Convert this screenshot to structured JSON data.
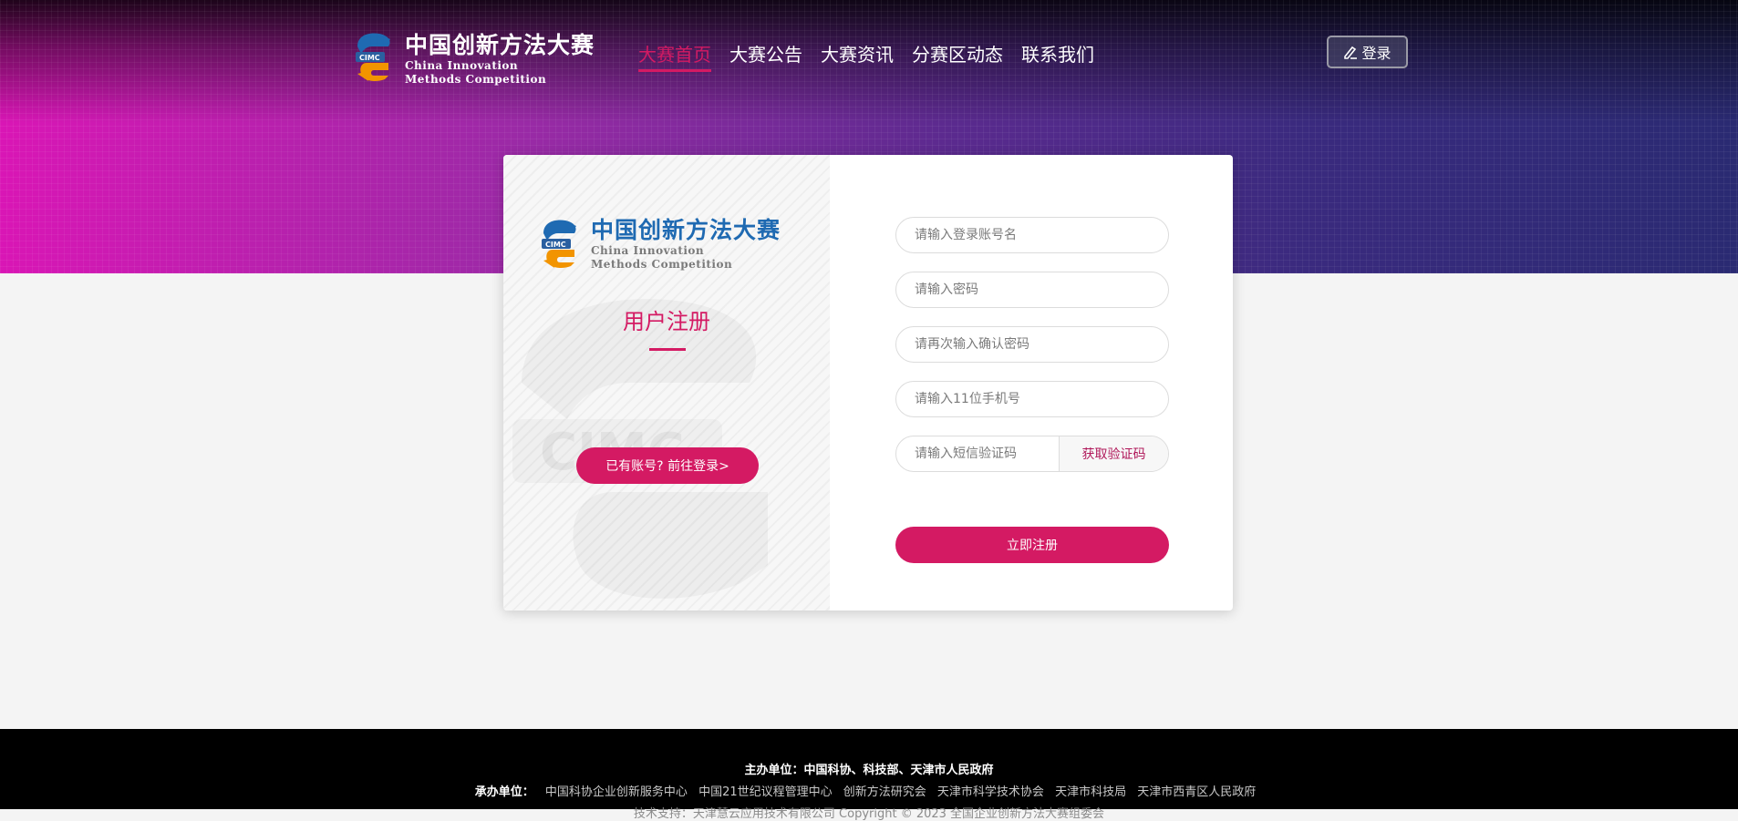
{
  "header": {
    "logo_cn": "中国创新方法大赛",
    "logo_en_line1": "China Innovation",
    "logo_en_line2": "Methods Competition",
    "nav": [
      "大赛首页",
      "大赛公告",
      "大赛资讯",
      "分赛区动态",
      "联系我们"
    ],
    "login_label": "登录"
  },
  "card": {
    "logo_cn": "中国创新方法大赛",
    "logo_en_line1": "China Innovation",
    "logo_en_line2": "Methods Competition",
    "title": "用户注册",
    "goto_login": "已有账号? 前往登录>",
    "fields": {
      "username_placeholder": "请输入登录账号名",
      "password_placeholder": "请输入密码",
      "confirm_placeholder": "请再次输入确认密码",
      "phone_placeholder": "请输入11位手机号",
      "sms_placeholder": "请输入短信验证码"
    },
    "sms_button": "获取验证码",
    "submit": "立即注册"
  },
  "footer": {
    "sponsor": "主办单位：中国科协、科技部、天津市人民政府",
    "organizer_label": "承办单位：",
    "organizers": [
      "中国科协企业创新服务中心",
      "中国21世纪议程管理中心",
      "创新方法研究会",
      "天津市科学技术协会",
      "天津市科技局",
      "天津市西青区人民政府"
    ],
    "copyright": "技术支持：天津慧云应用技术有限公司  Copyright © 2023 全国企业创新方法大赛组委会"
  },
  "colors": {
    "accent": "#d41a63",
    "logo_blue": "#1f6ab2",
    "logo_orange": "#f29400",
    "footer_bg": "#000000"
  },
  "icons": {
    "logo": "cimc-logo-icon",
    "login": "pen-icon",
    "watermark": "cimc-watermark-icon"
  }
}
